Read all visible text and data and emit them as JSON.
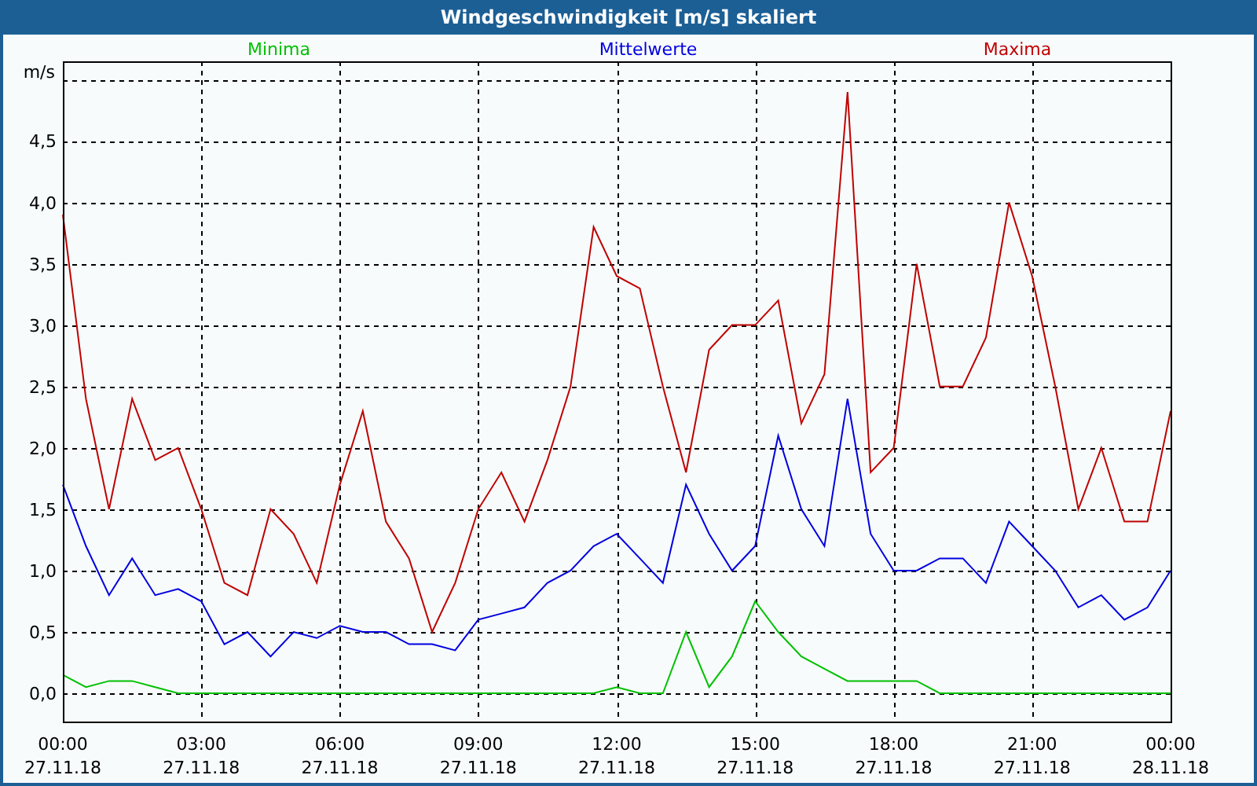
{
  "window": {
    "title": "Windgeschwindigkeit [m/s] skaliert"
  },
  "chart_data": {
    "type": "line",
    "grid": true,
    "ylabel": "m/s",
    "xlim": [
      0,
      24
    ],
    "ylim": [
      -0.23,
      5.15
    ],
    "x": [
      0,
      0.5,
      1,
      1.5,
      2,
      2.5,
      3,
      3.5,
      4,
      4.5,
      5,
      5.5,
      6,
      6.5,
      7,
      7.5,
      8,
      8.5,
      9,
      9.5,
      10,
      10.5,
      11,
      11.5,
      12,
      12.5,
      13,
      13.5,
      14,
      14.5,
      15,
      15.5,
      16,
      16.5,
      17,
      17.5,
      18,
      18.5,
      19,
      19.5,
      20,
      20.5,
      21,
      21.5,
      22,
      22.5,
      23,
      23.5,
      24
    ],
    "xticks": [
      {
        "value": 0,
        "label": "00:00"
      },
      {
        "value": 3,
        "label": "03:00"
      },
      {
        "value": 6,
        "label": "06:00"
      },
      {
        "value": 9,
        "label": "09:00"
      },
      {
        "value": 12,
        "label": "12:00"
      },
      {
        "value": 15,
        "label": "15:00"
      },
      {
        "value": 18,
        "label": "18:00"
      },
      {
        "value": 21,
        "label": "21:00"
      },
      {
        "value": 24,
        "label": "00:00"
      }
    ],
    "yticks": [
      {
        "value": 0,
        "label": "0,0"
      },
      {
        "value": 0.5,
        "label": "0,5"
      },
      {
        "value": 1,
        "label": "1,0"
      },
      {
        "value": 1.5,
        "label": "1,5"
      },
      {
        "value": 2,
        "label": "2,0"
      },
      {
        "value": 2.5,
        "label": "2,5"
      },
      {
        "value": 3,
        "label": "3,0"
      },
      {
        "value": 3.5,
        "label": "3,5"
      },
      {
        "value": 4,
        "label": "4,0"
      },
      {
        "value": 4.5,
        "label": "4,5"
      }
    ],
    "series": [
      {
        "name": "Minima",
        "color": "#00c000",
        "values": [
          0.15,
          0.05,
          0.1,
          0.1,
          0.05,
          0,
          0,
          0,
          0,
          0,
          0,
          0,
          0,
          0,
          0,
          0,
          0,
          0,
          0,
          0,
          0,
          0,
          0,
          0,
          0.05,
          0,
          0,
          0.5,
          0.05,
          0.3,
          0.75,
          0.5,
          0.3,
          0.2,
          0.1,
          0.1,
          0.1,
          0.1,
          0,
          0,
          0,
          0,
          0,
          0,
          0,
          0,
          0,
          0,
          0
        ]
      },
      {
        "name": "Mittelwerte",
        "color": "#0000e0",
        "values": [
          1.7,
          1.2,
          0.8,
          1.1,
          0.8,
          0.85,
          0.75,
          0.4,
          0.5,
          0.3,
          0.5,
          0.45,
          0.55,
          0.5,
          0.5,
          0.4,
          0.4,
          0.35,
          0.6,
          0.65,
          0.7,
          0.9,
          1.0,
          1.2,
          1.3,
          1.1,
          0.9,
          1.7,
          1.3,
          1.0,
          1.2,
          2.1,
          1.5,
          1.2,
          2.4,
          1.3,
          1.0,
          1.0,
          1.1,
          1.1,
          0.9,
          1.4,
          1.2,
          1.0,
          0.7,
          0.8,
          0.6,
          0.7,
          1.0
        ]
      },
      {
        "name": "Maxima",
        "color": "#c00000",
        "values": [
          3.9,
          2.4,
          1.5,
          2.4,
          1.9,
          2.0,
          1.5,
          0.9,
          0.8,
          1.5,
          1.3,
          0.9,
          1.7,
          2.3,
          1.4,
          1.1,
          0.5,
          0.9,
          1.5,
          1.8,
          1.4,
          1.9,
          2.5,
          3.8,
          3.4,
          3.3,
          2.5,
          1.8,
          2.8,
          3.0,
          3.0,
          3.2,
          2.2,
          2.6,
          4.9,
          1.8,
          2.0,
          3.5,
          2.5,
          2.5,
          2.9,
          4.0,
          3.4,
          2.5,
          1.5,
          2.0,
          1.4,
          1.4,
          2.3
        ]
      }
    ]
  },
  "x_axis_dates": [
    "27.11.18",
    "27.11.18",
    "27.11.18",
    "27.11.18",
    "27.11.18",
    "27.11.18",
    "27.11.18",
    "27.11.18",
    "28.11.18"
  ]
}
